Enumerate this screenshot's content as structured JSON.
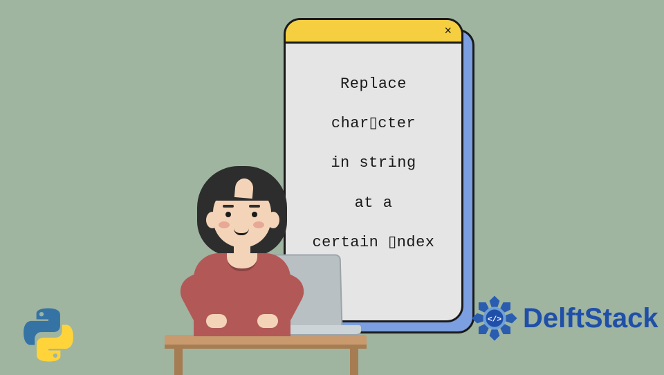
{
  "card": {
    "close": "×",
    "line1": "Replace",
    "line2": "char▯cter",
    "line3": "in string",
    "line4": "at a",
    "line5": "certain ▯ndex"
  },
  "brand": {
    "name": "DelftStack"
  }
}
